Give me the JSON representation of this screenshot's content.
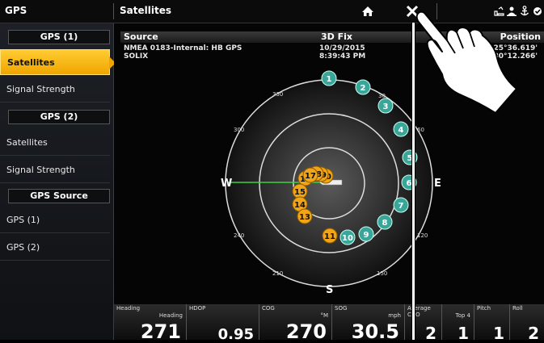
{
  "topbar": {
    "left_title": "GPS",
    "page_title": "Satellites",
    "icons": [
      "home-icon",
      "close-icon",
      "wifi-icon",
      "person-icon",
      "anchor-icon",
      "settings-icon"
    ]
  },
  "sidebar": {
    "headers": [
      "GPS (1)",
      "GPS (2)",
      "GPS Source"
    ],
    "items": [
      "Satellites",
      "Signal Strength",
      "Satellites",
      "Signal Strength",
      "GPS (1)",
      "GPS (2)"
    ],
    "selected_index": 0
  },
  "info": {
    "source_label": "Source",
    "fix_label": "3D Fix",
    "position_label": "Position",
    "source_line1": "NMEA 0183-Internal: HB GPS",
    "source_line2": "SOLIX",
    "date": "10/29/2015",
    "time": "8:39:43 PM",
    "lat": "N 25°36.619'",
    "lon": "W 80°12.266'"
  },
  "skyplot": {
    "compass": {
      "north": "N",
      "east": "E",
      "south": "S",
      "west": "W"
    },
    "bearing_labels": [
      "30",
      "60",
      "120",
      "150",
      "210",
      "240",
      "300",
      "330"
    ],
    "satellites_teal": [
      "1",
      "2",
      "3",
      "4",
      "5",
      "6",
      "7",
      "8",
      "9",
      "10"
    ],
    "satellites_orange": [
      "11",
      "12",
      "13",
      "14",
      "15",
      "16",
      "17",
      "18",
      "19",
      "20"
    ],
    "colors": {
      "teal": "#3aa69a",
      "orange": "#f2a516",
      "heading_line": "#3cd23c"
    }
  },
  "bottombar": [
    {
      "label": "Heading",
      "sub": "Heading",
      "value": "271"
    },
    {
      "label": "HDOP",
      "sub": "",
      "value": "0.95"
    },
    {
      "label": "COG",
      "sub": "°M",
      "value": "270"
    },
    {
      "label": "SOG",
      "sub": "mph",
      "value": "30.5"
    },
    {
      "label": "Average CNO",
      "sub": "",
      "value": "2"
    },
    {
      "label": "",
      "sub": "Top 4",
      "value": "1"
    },
    {
      "label": "Pitch",
      "sub": "",
      "value": "1"
    },
    {
      "label": "Roll",
      "sub": "",
      "value": "2"
    }
  ]
}
